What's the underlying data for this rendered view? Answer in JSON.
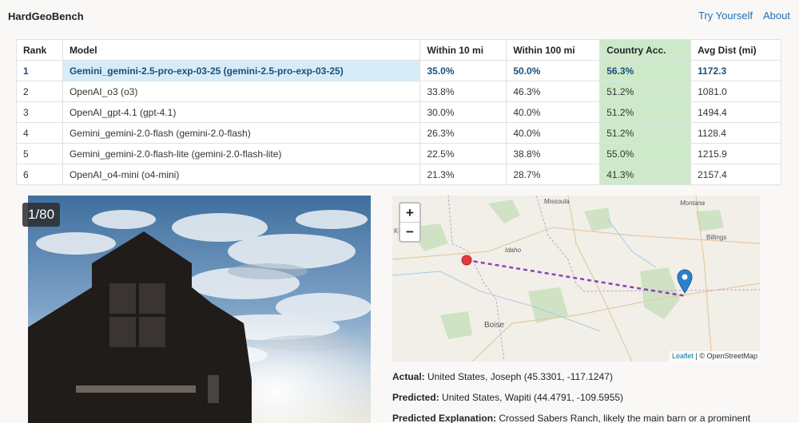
{
  "navbar": {
    "brand": "HardGeoBench",
    "links": [
      "Try Yourself",
      "About"
    ]
  },
  "leaderboard": {
    "headers": [
      "Rank",
      "Model",
      "Within 10 mi",
      "Within 100 mi",
      "Country Acc.",
      "Avg Dist (mi)"
    ],
    "rows": [
      [
        "1",
        "Gemini_gemini-2.5-pro-exp-03-25 (gemini-2.5-pro-exp-03-25)",
        "35.0%",
        "50.0%",
        "56.3%",
        "1172.3"
      ],
      [
        "2",
        "OpenAI_o3 (o3)",
        "33.8%",
        "46.3%",
        "51.2%",
        "1081.0"
      ],
      [
        "3",
        "OpenAI_gpt-4.1 (gpt-4.1)",
        "30.0%",
        "40.0%",
        "51.2%",
        "1494.4"
      ],
      [
        "4",
        "Gemini_gemini-2.0-flash (gemini-2.0-flash)",
        "26.3%",
        "40.0%",
        "51.2%",
        "1128.4"
      ],
      [
        "5",
        "Gemini_gemini-2.0-flash-lite (gemini-2.0-flash-lite)",
        "22.5%",
        "38.8%",
        "55.0%",
        "1215.9"
      ],
      [
        "6",
        "OpenAI_o4-mini (o4-mini)",
        "21.3%",
        "28.7%",
        "41.3%",
        "2157.4"
      ]
    ]
  },
  "image_viewer": {
    "counter": "1/80"
  },
  "map": {
    "labels": {
      "missoula": "Missoula",
      "montana": "Montana",
      "billings": "Billings",
      "idaho": "Idaho",
      "boise": "Boise",
      "lewiston": "Ke     ck"
    },
    "zoom_in": "+",
    "zoom_out": "−",
    "attribution_link": "Leaflet",
    "attribution_text": " | © OpenStreetMap",
    "colors": {
      "actual_marker": "#e03a3a",
      "predicted_marker": "#2a81cb",
      "line": "#8e44ad"
    }
  },
  "result": {
    "actual_label": "Actual:",
    "actual_value": "United States, Joseph (45.3301, -117.1247)",
    "predicted_label": "Predicted:",
    "predicted_value": "United States, Wapiti (44.4791, -109.5955)",
    "explanation_label": "Predicted Explanation:",
    "explanation_value": "Crossed Sabers Ranch, likely the main barn or a prominent building on the property. The text on the building clearly identifies it as 'CROSSED"
  }
}
